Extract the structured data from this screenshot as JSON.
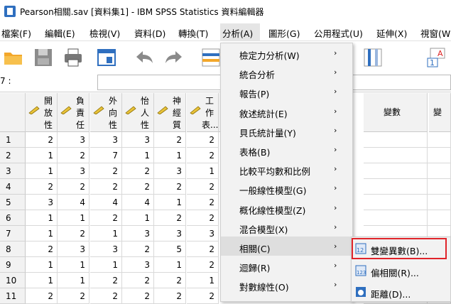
{
  "window": {
    "title": "Pearson相關.sav [資料集1] - IBM SPSS Statistics 資料編輯器"
  },
  "menubar": {
    "items": [
      "檔案(F)",
      "編輯(E)",
      "檢視(V)",
      "資料(D)",
      "轉換(T)",
      "分析(A)",
      "圖形(G)",
      "公用程式(U)",
      "延伸(X)",
      "視窗(W"
    ]
  },
  "toolbar": {
    "icons": [
      "open-folder-icon",
      "save-icon",
      "print-icon",
      "dialog-recall-icon",
      "undo-icon",
      "redo-icon",
      "goto-case-icon",
      "variables-icon",
      "goto-variable-icon"
    ]
  },
  "cellbar": {
    "ref": "7 :",
    "value": ""
  },
  "grid": {
    "columns": [
      {
        "label": "開\n放\n性",
        "measure": "ordinal"
      },
      {
        "label": "負\n責\n任",
        "measure": "ordinal"
      },
      {
        "label": "外\n向\n性",
        "measure": "ordinal"
      },
      {
        "label": "怡\n人\n性",
        "measure": "ordinal"
      },
      {
        "label": "神\n經\n質",
        "measure": "ordinal"
      },
      {
        "label": "工\n作\n表...",
        "measure": "ordinal"
      }
    ],
    "extra_headers": [
      "數",
      "變數",
      "變"
    ],
    "row_numbers": [
      "1",
      "2",
      "3",
      "4",
      "5",
      "6",
      "7",
      "8",
      "9",
      "10",
      "11"
    ],
    "rows": [
      [
        "2",
        "3",
        "3",
        "3",
        "2",
        "2"
      ],
      [
        "1",
        "2",
        "7",
        "1",
        "1",
        "2"
      ],
      [
        "1",
        "3",
        "2",
        "2",
        "3",
        "1"
      ],
      [
        "2",
        "2",
        "2",
        "2",
        "2",
        "2"
      ],
      [
        "3",
        "4",
        "4",
        "4",
        "1",
        "2"
      ],
      [
        "1",
        "1",
        "2",
        "1",
        "2",
        "2"
      ],
      [
        "1",
        "2",
        "1",
        "3",
        "3",
        "3"
      ],
      [
        "2",
        "3",
        "3",
        "2",
        "5",
        "2"
      ],
      [
        "1",
        "1",
        "1",
        "3",
        "1",
        "2"
      ],
      [
        "1",
        "1",
        "2",
        "2",
        "2",
        "1"
      ],
      [
        "2",
        "2",
        "2",
        "2",
        "2",
        "2"
      ]
    ]
  },
  "analyze_menu": {
    "items": [
      {
        "label": "檢定力分析(W)",
        "has_submenu": true
      },
      {
        "label": "統合分析",
        "has_submenu": true
      },
      {
        "label": "報告(P)",
        "has_submenu": true
      },
      {
        "label": "敘述統計(E)",
        "has_submenu": true
      },
      {
        "label": "貝氏統計量(Y)",
        "has_submenu": true
      },
      {
        "label": "表格(B)",
        "has_submenu": true
      },
      {
        "label": "比較平均數和比例",
        "has_submenu": true
      },
      {
        "label": "一般線性模型(G)",
        "has_submenu": true
      },
      {
        "label": "概化線性模型(Z)",
        "has_submenu": true
      },
      {
        "label": "混合模型(X)",
        "has_submenu": true
      },
      {
        "label": "相關(C)",
        "has_submenu": true,
        "highlighted": true
      },
      {
        "label": "迴歸(R)",
        "has_submenu": true
      },
      {
        "label": "對數線性(O)",
        "has_submenu": true
      }
    ],
    "arrow_glyph": "›"
  },
  "correlate_submenu": {
    "items": [
      {
        "label": "雙變異數(B)...",
        "icon": "bivariate-icon",
        "highlighted": true
      },
      {
        "label": "偏相關(R)...",
        "icon": "partial-correlation-icon"
      },
      {
        "label": "距離(D)...",
        "icon": "distance-icon"
      }
    ],
    "highlight_color": "#e0242a"
  },
  "colors": {
    "accent_blue": "#2f6fbf",
    "highlight_red": "#e0242a"
  }
}
